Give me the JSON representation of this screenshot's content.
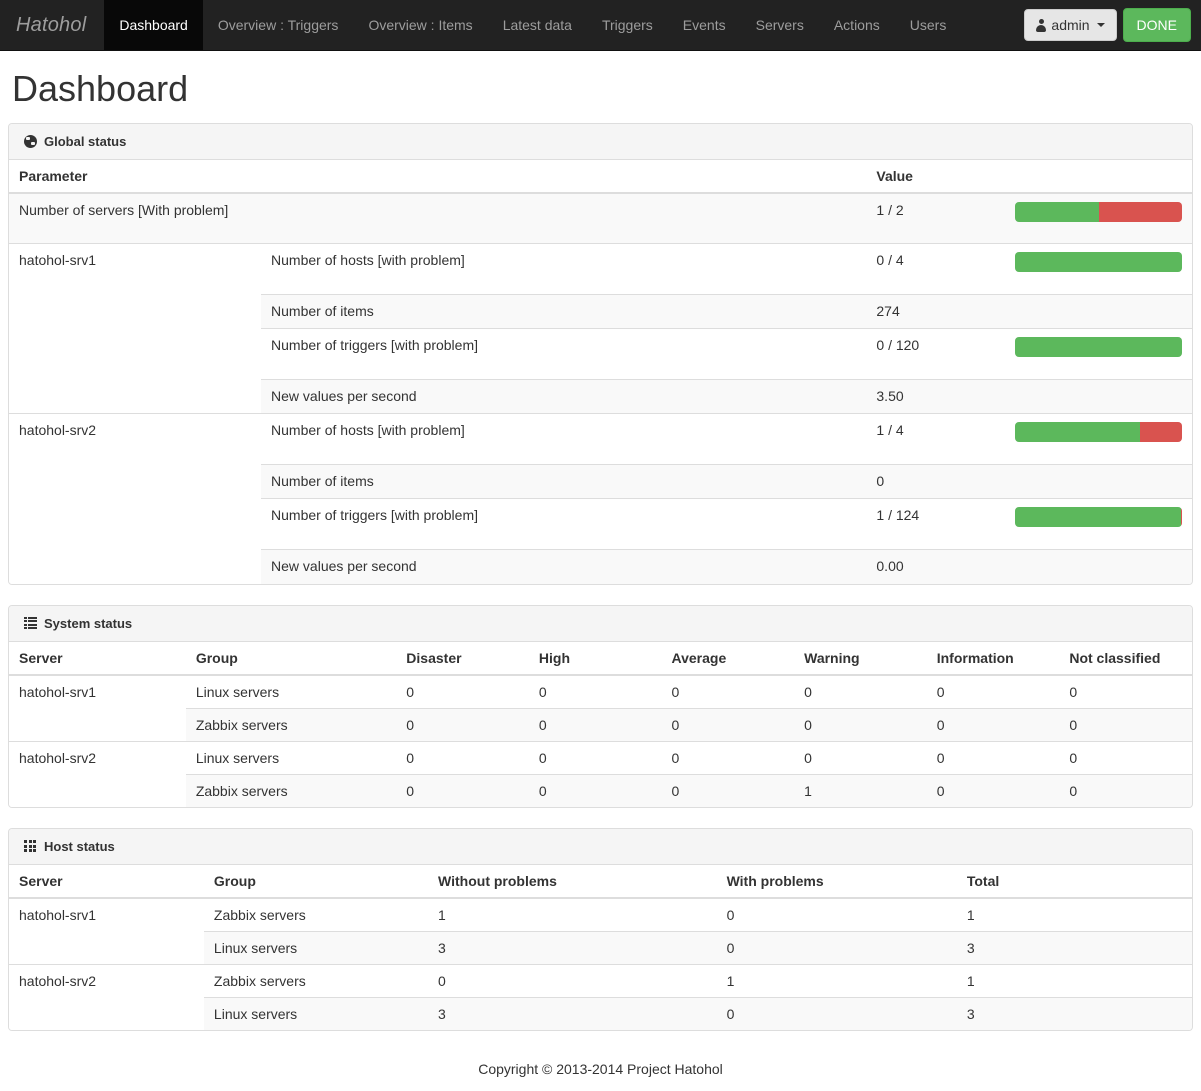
{
  "navbar": {
    "brand": "Hatohol",
    "links": [
      {
        "label": "Dashboard",
        "active": true
      },
      {
        "label": "Overview : Triggers",
        "active": false
      },
      {
        "label": "Overview : Items",
        "active": false
      },
      {
        "label": "Latest data",
        "active": false
      },
      {
        "label": "Triggers",
        "active": false
      },
      {
        "label": "Events",
        "active": false
      },
      {
        "label": "Servers",
        "active": false
      },
      {
        "label": "Actions",
        "active": false
      },
      {
        "label": "Users",
        "active": false
      }
    ],
    "user_button": "admin",
    "done_button": "DONE"
  },
  "page": {
    "title": "Dashboard"
  },
  "colors": {
    "ok": "#5cb85c",
    "problem": "#d9534f",
    "navbar_bg": "#222222",
    "panel_head_bg": "#f5f5f5"
  },
  "global_status": {
    "panel_title": "Global status",
    "icon": "globe-icon",
    "headers": {
      "parameter": "Parameter",
      "value": "Value"
    },
    "servers_row": {
      "label": "Number of servers [With problem]",
      "value": "1 / 2",
      "bar": {
        "ok_pct": 50,
        "bad_pct": 50
      }
    },
    "servers": [
      {
        "name": "hatohol-srv1",
        "rows": [
          {
            "label": "Number of hosts [with problem]",
            "value": "0 / 4",
            "bar": {
              "ok_pct": 100,
              "bad_pct": 0
            }
          },
          {
            "label": "Number of items",
            "value": "274",
            "bar": null
          },
          {
            "label": "Number of triggers [with problem]",
            "value": "0 / 120",
            "bar": {
              "ok_pct": 100,
              "bad_pct": 0
            }
          },
          {
            "label": "New values per second",
            "value": "3.50",
            "bar": null
          }
        ]
      },
      {
        "name": "hatohol-srv2",
        "rows": [
          {
            "label": "Number of hosts [with problem]",
            "value": "1 / 4",
            "bar": {
              "ok_pct": 75,
              "bad_pct": 25
            }
          },
          {
            "label": "Number of items",
            "value": "0",
            "bar": null
          },
          {
            "label": "Number of triggers [with problem]",
            "value": "1 / 124",
            "bar": {
              "ok_pct": 99.2,
              "bad_pct": 0.8
            }
          },
          {
            "label": "New values per second",
            "value": "0.00",
            "bar": null
          }
        ]
      }
    ]
  },
  "system_status": {
    "panel_title": "System status",
    "icon": "list-icon",
    "headers": [
      "Server",
      "Group",
      "Disaster",
      "High",
      "Average",
      "Warning",
      "Information",
      "Not classified"
    ],
    "rows": [
      {
        "server": "hatohol-srv1",
        "rowspan": 2,
        "group": "Linux servers",
        "values": [
          "0",
          "0",
          "0",
          "0",
          "0",
          "0"
        ]
      },
      {
        "server": null,
        "rowspan": 0,
        "group": "Zabbix servers",
        "values": [
          "0",
          "0",
          "0",
          "0",
          "0",
          "0"
        ]
      },
      {
        "server": "hatohol-srv2",
        "rowspan": 2,
        "group": "Linux servers",
        "values": [
          "0",
          "0",
          "0",
          "0",
          "0",
          "0"
        ]
      },
      {
        "server": null,
        "rowspan": 0,
        "group": "Zabbix servers",
        "values": [
          "0",
          "0",
          "0",
          "1",
          "0",
          "0"
        ]
      }
    ]
  },
  "host_status": {
    "panel_title": "Host status",
    "icon": "grid-icon",
    "headers": [
      "Server",
      "Group",
      "Without problems",
      "With problems",
      "Total"
    ],
    "rows": [
      {
        "server": "hatohol-srv1",
        "rowspan": 2,
        "group": "Zabbix servers",
        "values": [
          "1",
          "0",
          "1"
        ]
      },
      {
        "server": null,
        "rowspan": 0,
        "group": "Linux servers",
        "values": [
          "3",
          "0",
          "3"
        ]
      },
      {
        "server": "hatohol-srv2",
        "rowspan": 2,
        "group": "Zabbix servers",
        "values": [
          "0",
          "1",
          "1"
        ]
      },
      {
        "server": null,
        "rowspan": 0,
        "group": "Linux servers",
        "values": [
          "3",
          "0",
          "3"
        ]
      }
    ]
  },
  "footer": {
    "copyright": "Copyright © 2013-2014 Project Hatohol"
  }
}
